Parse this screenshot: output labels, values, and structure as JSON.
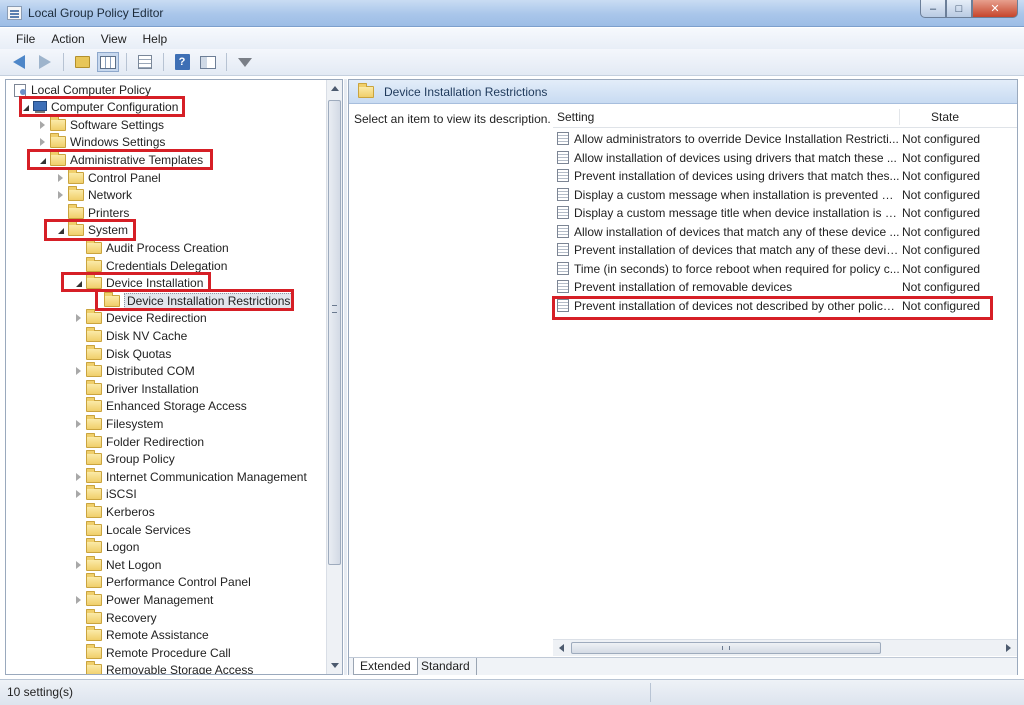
{
  "window": {
    "title": "Local Group Policy Editor",
    "controls": {
      "minimize": "–",
      "maximize": "□",
      "close": "✕"
    }
  },
  "menu": [
    "File",
    "Action",
    "View",
    "Help"
  ],
  "toolbar": {
    "icons": [
      "back-icon",
      "forward-icon",
      "up-folder-icon",
      "show-hide-tree-icon",
      "export-list-icon",
      "help-icon",
      "properties-pane-icon",
      "filter-icon"
    ],
    "help_glyph": "?"
  },
  "tree": {
    "items": [
      {
        "label": "Local Computer Policy",
        "icon": "policy-icon",
        "twisty": "none"
      },
      {
        "label": "Computer Configuration",
        "icon": "computer-icon",
        "twisty": "open"
      },
      {
        "label": "Software Settings",
        "icon": "folder-icon",
        "twisty": "closed"
      },
      {
        "label": "Windows Settings",
        "icon": "folder-icon",
        "twisty": "closed"
      },
      {
        "label": "Administrative Templates",
        "icon": "folder-icon",
        "twisty": "open"
      },
      {
        "label": "Control Panel",
        "icon": "folder-icon",
        "twisty": "closed"
      },
      {
        "label": "Network",
        "icon": "folder-icon",
        "twisty": "closed"
      },
      {
        "label": "Printers",
        "icon": "folder-icon",
        "twisty": "none"
      },
      {
        "label": "System",
        "icon": "folder-icon",
        "twisty": "open"
      },
      {
        "label": "Audit Process Creation",
        "icon": "folder-icon",
        "twisty": "none"
      },
      {
        "label": "Credentials Delegation",
        "icon": "folder-icon",
        "twisty": "none"
      },
      {
        "label": "Device Installation",
        "icon": "folder-icon",
        "twisty": "open"
      },
      {
        "label": "Device Installation Restrictions",
        "icon": "folder-icon",
        "twisty": "none",
        "selected": true
      },
      {
        "label": "Device Redirection",
        "icon": "folder-icon",
        "twisty": "closed"
      },
      {
        "label": "Disk NV Cache",
        "icon": "folder-icon",
        "twisty": "none"
      },
      {
        "label": "Disk Quotas",
        "icon": "folder-icon",
        "twisty": "none"
      },
      {
        "label": "Distributed COM",
        "icon": "folder-icon",
        "twisty": "closed"
      },
      {
        "label": "Driver Installation",
        "icon": "folder-icon",
        "twisty": "none"
      },
      {
        "label": "Enhanced Storage Access",
        "icon": "folder-icon",
        "twisty": "none"
      },
      {
        "label": "Filesystem",
        "icon": "folder-icon",
        "twisty": "closed"
      },
      {
        "label": "Folder Redirection",
        "icon": "folder-icon",
        "twisty": "none"
      },
      {
        "label": "Group Policy",
        "icon": "folder-icon",
        "twisty": "none"
      },
      {
        "label": "Internet Communication Management",
        "icon": "folder-icon",
        "twisty": "closed"
      },
      {
        "label": "iSCSI",
        "icon": "folder-icon",
        "twisty": "closed"
      },
      {
        "label": "Kerberos",
        "icon": "folder-icon",
        "twisty": "none"
      },
      {
        "label": "Locale Services",
        "icon": "folder-icon",
        "twisty": "none"
      },
      {
        "label": "Logon",
        "icon": "folder-icon",
        "twisty": "none"
      },
      {
        "label": "Net Logon",
        "icon": "folder-icon",
        "twisty": "closed"
      },
      {
        "label": "Performance Control Panel",
        "icon": "folder-icon",
        "twisty": "none"
      },
      {
        "label": "Power Management",
        "icon": "folder-icon",
        "twisty": "closed"
      },
      {
        "label": "Recovery",
        "icon": "folder-icon",
        "twisty": "none"
      },
      {
        "label": "Remote Assistance",
        "icon": "folder-icon",
        "twisty": "none"
      },
      {
        "label": "Remote Procedure Call",
        "icon": "folder-icon",
        "twisty": "none"
      },
      {
        "label": "Removable Storage Access",
        "icon": "folder-icon",
        "twisty": "none"
      }
    ]
  },
  "right_pane": {
    "header": "Device Installation Restrictions",
    "description": "Select an item to view its description.",
    "columns": {
      "setting": "Setting",
      "state": "State"
    },
    "rows": [
      {
        "setting": "Allow administrators to override Device Installation Restricti...",
        "state": "Not configured"
      },
      {
        "setting": "Allow installation of devices using drivers that match these ...",
        "state": "Not configured"
      },
      {
        "setting": "Prevent installation of devices using drivers that match thes...",
        "state": "Not configured"
      },
      {
        "setting": "Display a custom message when installation is prevented by...",
        "state": "Not configured"
      },
      {
        "setting": "Display a custom message title when device installation is pr...",
        "state": "Not configured"
      },
      {
        "setting": "Allow installation of devices that match any of these device ...",
        "state": "Not configured"
      },
      {
        "setting": "Prevent installation of devices that match any of these devic...",
        "state": "Not configured"
      },
      {
        "setting": "Time (in seconds) to force reboot when required for policy c...",
        "state": "Not configured"
      },
      {
        "setting": "Prevent installation of removable devices",
        "state": "Not configured"
      },
      {
        "setting": "Prevent installation of devices not described by other policy ...",
        "state": "Not configured"
      }
    ],
    "tabs": [
      "Extended",
      "Standard"
    ]
  },
  "status": {
    "text": "10 setting(s)"
  },
  "colors": {
    "highlight": "#d61f26",
    "header_text": "#1e395b"
  }
}
